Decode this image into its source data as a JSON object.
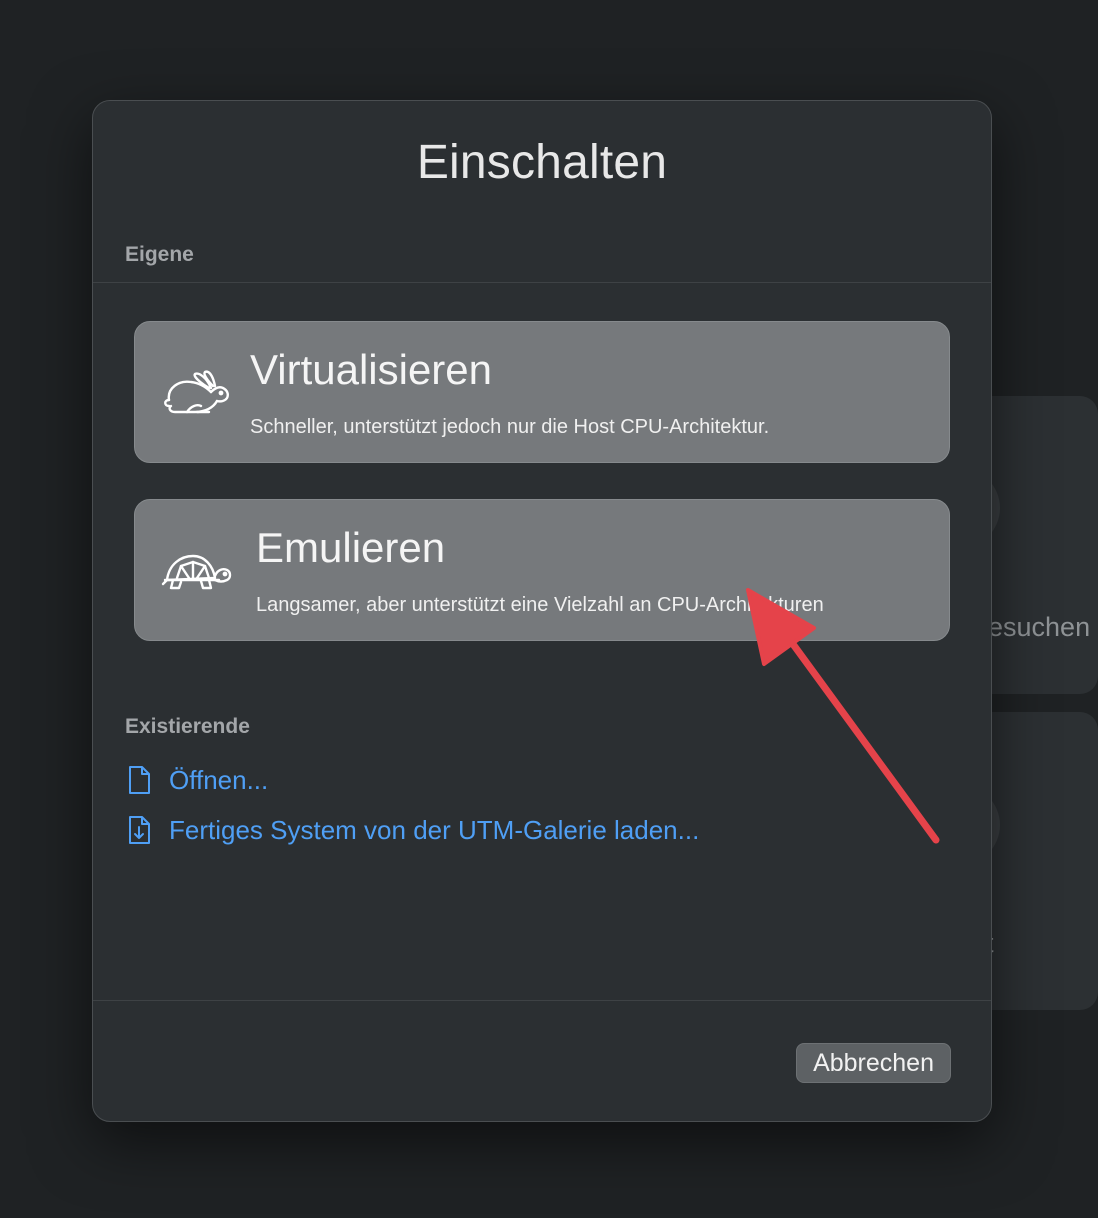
{
  "background": {
    "card1_text": "esuchen",
    "card2_text": "t"
  },
  "dialog": {
    "title": "Einschalten",
    "own_section_label": "Eigene",
    "options": [
      {
        "title": "Virtualisieren",
        "description": "Schneller, unterstützt jedoch nur die Host CPU-Architektur.",
        "icon": "rabbit-icon"
      },
      {
        "title": "Emulieren",
        "description": "Langsamer, aber unterstützt eine Vielzahl an CPU-Architekturen",
        "icon": "turtle-icon"
      }
    ],
    "existing_section_label": "Existierende",
    "links": [
      {
        "label": "Öffnen...",
        "icon": "document-icon"
      },
      {
        "label": "Fertiges System von der UTM-Galerie laden...",
        "icon": "document-download-icon"
      }
    ],
    "cancel_label": "Abbrechen"
  },
  "colors": {
    "link": "#4f9ff5",
    "annotation_arrow": "#e5434a",
    "option_background": "#76797c"
  }
}
